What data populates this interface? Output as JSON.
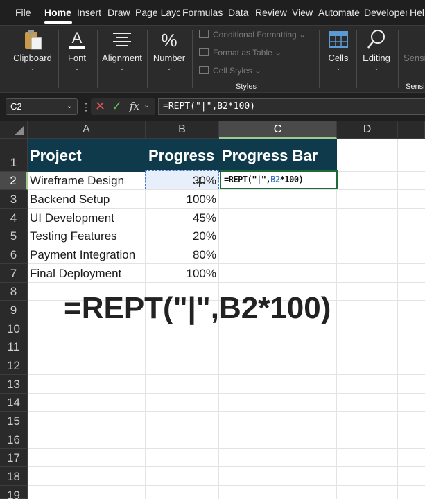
{
  "tabs": [
    "File",
    "Home",
    "Insert",
    "Draw",
    "Page Layc",
    "Formulas",
    "Data",
    "Review",
    "View",
    "Automate",
    "Developer",
    "Hel"
  ],
  "active_tab": "Home",
  "ribbon": {
    "clipboard": "Clipboard",
    "font": "Font",
    "alignment": "Alignment",
    "number": "Number",
    "conditional_formatting": "Conditional Formatting",
    "format_as_table": "Format as Table",
    "cell_styles": "Cell Styles",
    "styles_group": "Styles",
    "cells": "Cells",
    "editing": "Editing",
    "sensitivity": "Sensiti",
    "sensitivity_group": "Sensit"
  },
  "formula_bar": {
    "name_box": "C2",
    "formula": "=REPT(\"|\",B2*100)"
  },
  "columns": [
    "A",
    "B",
    "C",
    "D"
  ],
  "rows": [
    "1",
    "2",
    "3",
    "4",
    "5",
    "6",
    "7",
    "8",
    "9",
    "10",
    "11",
    "12",
    "13",
    "14",
    "15",
    "16",
    "17",
    "18",
    "19"
  ],
  "table": {
    "headers": [
      "Project",
      "Progress",
      "Progress Bar"
    ],
    "rows": [
      {
        "project": "Wireframe Design",
        "progress": "30%"
      },
      {
        "project": "Backend Setup",
        "progress": "100%"
      },
      {
        "project": "UI Development",
        "progress": "45%"
      },
      {
        "project": "Testing Features",
        "progress": "20%"
      },
      {
        "project": "Payment Integration",
        "progress": "80%"
      },
      {
        "project": "Final Deployment",
        "progress": "100%"
      }
    ]
  },
  "cell_edit": {
    "prefix": "=REPT(\"|\",",
    "ref": "B2",
    "suffix": "*100)"
  },
  "overlay_formula": "=REPT(\"|\",B2*100)",
  "colors": {
    "header_band": "#0e3a4c",
    "selection_green": "#1e6b3a",
    "reference_blue": "#3d74c5"
  }
}
